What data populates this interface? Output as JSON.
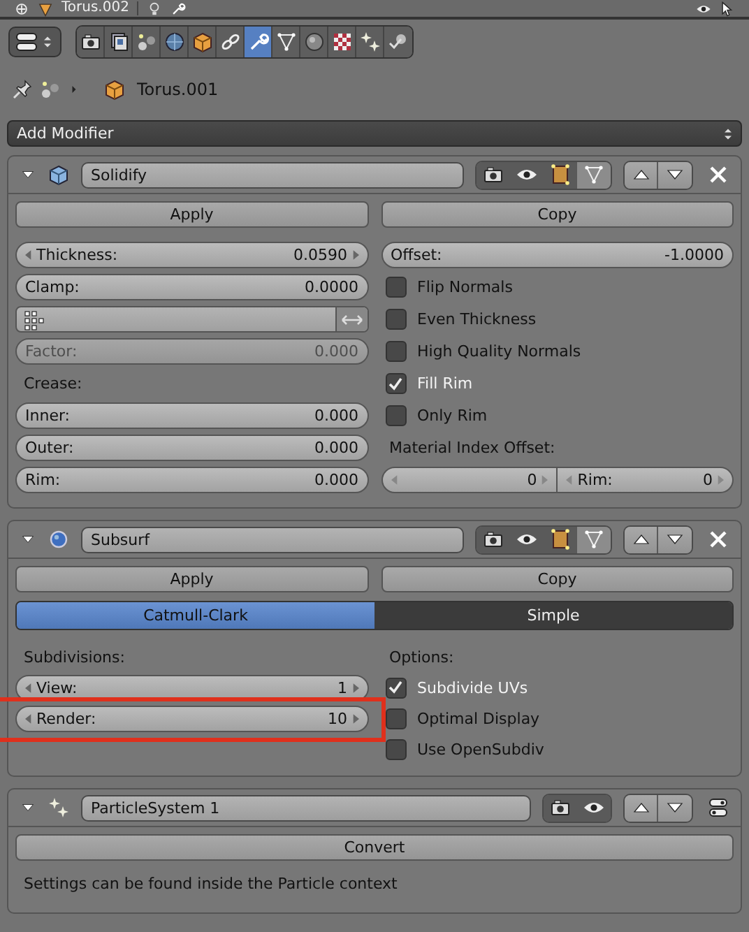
{
  "editor_header": {
    "object": "Torus.002"
  },
  "context_tabs": [
    {
      "selected": false
    },
    {
      "selected": false
    },
    {
      "selected": false
    },
    {
      "selected": false
    },
    {
      "selected": false
    },
    {
      "selected": false
    },
    {
      "selected": true
    },
    {
      "selected": false
    },
    {
      "selected": false
    },
    {
      "selected": false
    },
    {
      "selected": false
    },
    {
      "selected": false
    }
  ],
  "breadcrumb": {
    "object": "Torus.001"
  },
  "add_modifier": {
    "label": "Add Modifier"
  },
  "modifiers": [
    {
      "kind": "solidify",
      "name": "Solidify",
      "expanded": true,
      "toggles": [
        {
          "kind": "render",
          "on": true
        },
        {
          "kind": "viewport",
          "on": true
        },
        {
          "kind": "editmode",
          "on": true
        },
        {
          "kind": "cage",
          "on": false
        }
      ],
      "apply": "Apply",
      "copy": "Copy",
      "left": [
        {
          "kind": "field",
          "label": "Thickness:",
          "value": "0.0590",
          "arrows": true,
          "disabled": false,
          "highlighted": false
        },
        {
          "kind": "field",
          "label": "Clamp:",
          "value": "0.0000",
          "arrows": false,
          "disabled": false,
          "highlighted": false
        },
        {
          "kind": "group"
        },
        {
          "kind": "field",
          "label": "Factor:",
          "value": "0.000",
          "arrows": false,
          "disabled": true,
          "highlighted": false
        },
        {
          "kind": "label",
          "text": "Crease:"
        },
        {
          "kind": "field",
          "label": "Inner:",
          "value": "0.000",
          "arrows": false,
          "disabled": false,
          "highlighted": false
        },
        {
          "kind": "field",
          "label": "Outer:",
          "value": "0.000",
          "arrows": false,
          "disabled": false,
          "highlighted": false
        },
        {
          "kind": "field",
          "label": "Rim:",
          "value": "0.000",
          "arrows": false,
          "disabled": false,
          "highlighted": false
        }
      ],
      "right": [
        {
          "kind": "field",
          "label": "Offset:",
          "value": "-1.0000",
          "arrows": false,
          "disabled": false,
          "highlighted": false
        },
        {
          "kind": "checkbox",
          "label": "Flip Normals",
          "checked": false
        },
        {
          "kind": "checkbox",
          "label": "Even Thickness",
          "checked": false
        },
        {
          "kind": "checkbox",
          "label": "High Quality Normals",
          "checked": false
        },
        {
          "kind": "checkbox",
          "label": "Fill Rim",
          "checked": true
        },
        {
          "kind": "checkbox",
          "label": "Only Rim",
          "checked": false
        },
        {
          "kind": "label",
          "text": "Material Index Offset:"
        },
        {
          "kind": "pair",
          "value": "0",
          "label2": "Rim:",
          "value2": "0"
        }
      ]
    },
    {
      "kind": "subsurf",
      "name": "Subsurf",
      "expanded": true,
      "toggles": [
        {
          "kind": "render",
          "on": true
        },
        {
          "kind": "viewport",
          "on": true
        },
        {
          "kind": "editmode",
          "on": true
        },
        {
          "kind": "cage",
          "on": false
        }
      ],
      "apply": "Apply",
      "copy": "Copy",
      "modes": [
        {
          "label": "Catmull-Clark",
          "selected": true
        },
        {
          "label": "Simple",
          "selected": false
        }
      ],
      "left": [
        {
          "kind": "label",
          "text": "Subdivisions:"
        },
        {
          "kind": "field",
          "label": "View:",
          "value": "1",
          "arrows": true,
          "disabled": false,
          "highlighted": false
        },
        {
          "kind": "field",
          "label": "Render:",
          "value": "10",
          "arrows": true,
          "disabled": false,
          "highlighted": true
        }
      ],
      "right": [
        {
          "kind": "label",
          "text": "Options:"
        },
        {
          "kind": "checkbox",
          "label": "Subdivide UVs",
          "checked": true
        },
        {
          "kind": "checkbox",
          "label": "Optimal Display",
          "checked": false
        },
        {
          "kind": "checkbox",
          "label": "Use OpenSubdiv",
          "checked": false
        }
      ]
    },
    {
      "kind": "particles",
      "name": "ParticleSystem 1",
      "expanded": true,
      "toggles": [
        {
          "kind": "render",
          "on": true
        },
        {
          "kind": "viewport",
          "on": true
        }
      ],
      "convert": "Convert",
      "note": "Settings can be found inside the Particle context"
    }
  ]
}
